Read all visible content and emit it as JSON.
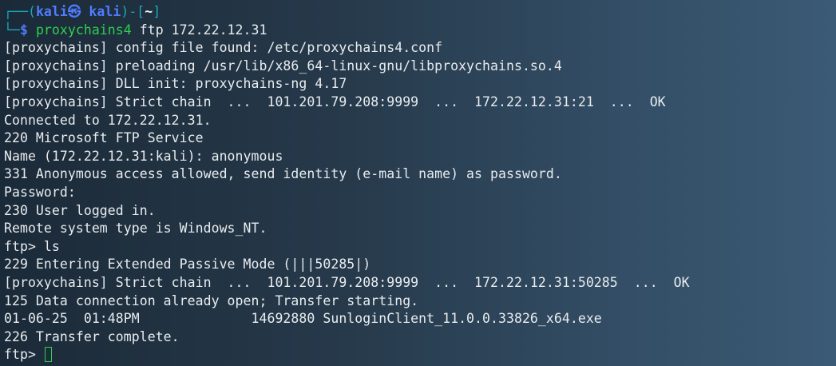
{
  "theme": {
    "accent_prompt": "#4f7cff",
    "accent_deco": "#1aa8b8",
    "command_color": "#2fcf4f",
    "text_color": "#e8ecef"
  },
  "prompt": {
    "top_left_deco": "┌──(",
    "user_host": "kali㉿ kali",
    "mid_deco": ")-[",
    "cwd": "~",
    "end_deco": "]",
    "bottom_deco": "└─",
    "dollar": "$",
    "command": "proxychains4",
    "args": " ftp 172.22.12.31"
  },
  "output_lines": [
    "[proxychains] config file found: /etc/proxychains4.conf",
    "[proxychains] preloading /usr/lib/x86_64-linux-gnu/libproxychains.so.4",
    "[proxychains] DLL init: proxychains-ng 4.17",
    "[proxychains] Strict chain  ...  101.201.79.208:9999  ...  172.22.12.31:21  ...  OK",
    "Connected to 172.22.12.31.",
    "220 Microsoft FTP Service",
    "Name (172.22.12.31:kali): anonymous",
    "331 Anonymous access allowed, send identity (e-mail name) as password.",
    "Password:",
    "230 User logged in.",
    "Remote system type is Windows_NT.",
    "ftp> ls",
    "229 Entering Extended Passive Mode (|||50285|)",
    "[proxychains] Strict chain  ...  101.201.79.208:9999  ...  172.22.12.31:50285  ...  OK",
    "125 Data connection already open; Transfer starting.",
    "01-06-25  01:48PM              14692880 SunloginClient_11.0.0.33826_x64.exe",
    "226 Transfer complete."
  ],
  "ftp_prompt": "ftp> "
}
